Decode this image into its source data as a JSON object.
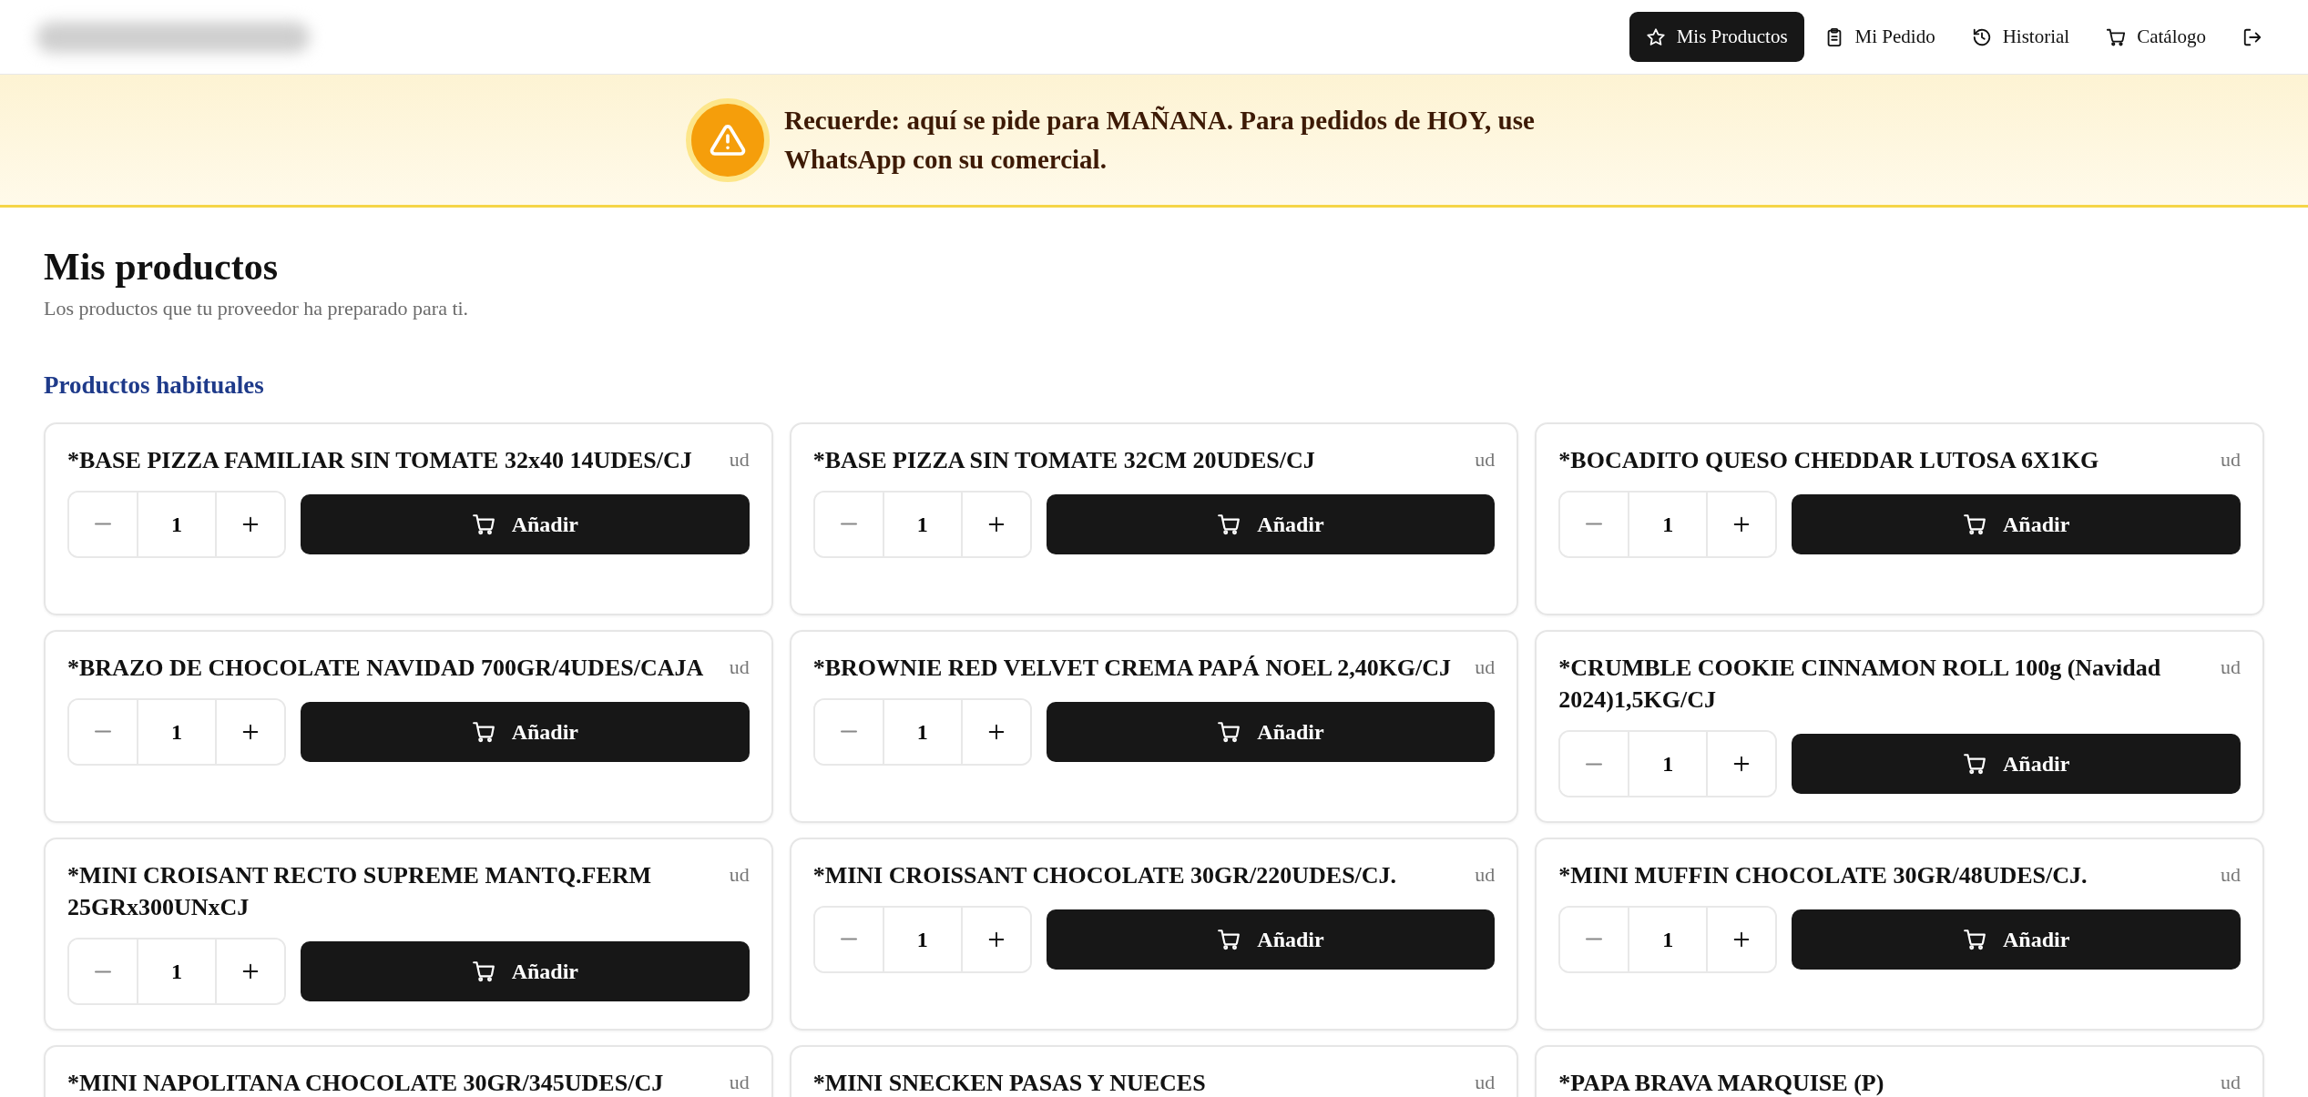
{
  "nav": {
    "items": [
      {
        "label": "Mis Productos",
        "selected": true
      },
      {
        "label": "Mi Pedido",
        "selected": false
      },
      {
        "label": "Historial",
        "selected": false
      },
      {
        "label": "Catálogo",
        "selected": false
      },
      {
        "selected": false
      }
    ]
  },
  "banner": {
    "text": "Recuerde: aquí se pide para MAÑANA. Para pedidos de HOY, use WhatsApp con su comercial."
  },
  "page": {
    "title": "Mis productos",
    "subtitle": "Los productos que tu proveedor ha preparado para ti."
  },
  "sections": [
    {
      "title": "Productos habituales",
      "products": [
        {
          "name": "*BASE PIZZA FAMILIAR SIN TOMATE 32x40 14UDES/CJ",
          "unit": "ud",
          "quantity": "1",
          "button": "Añadir"
        },
        {
          "name": "*BASE PIZZA SIN TOMATE 32CM 20UDES/CJ",
          "unit": "ud",
          "quantity": "1",
          "button": "Añadir"
        },
        {
          "name": "*BOCADITO QUESO CHEDDAR LUTOSA 6X1KG",
          "unit": "ud",
          "quantity": "1",
          "button": "Añadir"
        },
        {
          "name": "*BRAZO DE CHOCOLATE NAVIDAD 700GR/4UDES/CAJA",
          "unit": "ud",
          "quantity": "1",
          "button": "Añadir"
        },
        {
          "name": "*BROWNIE RED VELVET CREMA PAPÁ NOEL 2,40KG/CJ",
          "unit": "ud",
          "quantity": "1",
          "button": "Añadir"
        },
        {
          "name": "*CRUMBLE COOKIE CINNAMON ROLL 100g (Navidad 2024)1,5KG/CJ",
          "unit": "ud",
          "quantity": "1",
          "button": "Añadir"
        },
        {
          "name": "*MINI CROISANT RECTO SUPREME MANTQ.FERM 25GRx300UNxCJ",
          "unit": "ud",
          "quantity": "1",
          "button": "Añadir"
        },
        {
          "name": "*MINI CROISSANT CHOCOLATE 30GR/220UDES/CJ.",
          "unit": "ud",
          "quantity": "1",
          "button": "Añadir"
        },
        {
          "name": "*MINI MUFFIN CHOCOLATE 30GR/48UDES/CJ.",
          "unit": "ud",
          "quantity": "1",
          "button": "Añadir"
        },
        {
          "name": "*MINI NAPOLITANA CHOCOLATE 30GR/345UDES/CJ",
          "unit": "ud"
        },
        {
          "name": "*MINI SNECKEN PASAS Y NUECES",
          "unit": "ud"
        },
        {
          "name": "*PAPA BRAVA MARQUISE (P)",
          "unit": "ud"
        }
      ]
    }
  ]
}
